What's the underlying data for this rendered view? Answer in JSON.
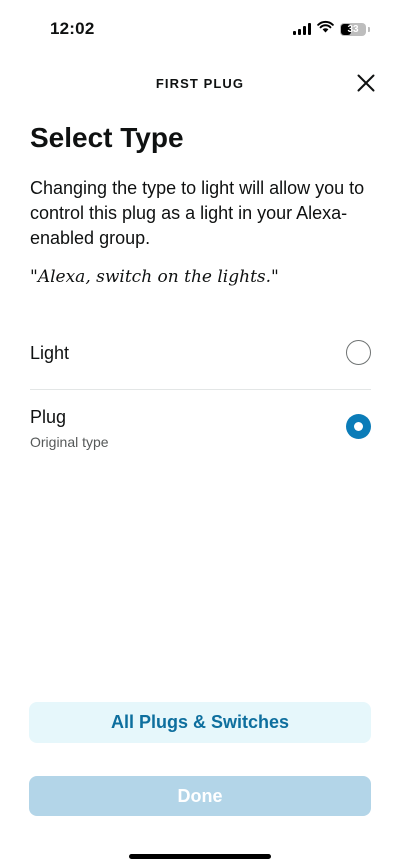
{
  "status_bar": {
    "time": "12:02",
    "battery_level": "33"
  },
  "header": {
    "title": "FIRST PLUG"
  },
  "page": {
    "title": "Select Type",
    "description": "Changing the type to light will allow you to control this plug as a light in your Alexa-enabled group.",
    "quote": "\"Alexa, switch on the lights.\""
  },
  "options": [
    {
      "label": "Light",
      "sublabel": "",
      "selected": false
    },
    {
      "label": "Plug",
      "sublabel": "Original type",
      "selected": true
    }
  ],
  "buttons": {
    "all_plugs_label": "All Plugs & Switches",
    "done_label": "Done"
  },
  "colors": {
    "accent": "#0b7cb8",
    "secondary_button_bg": "#e6f7fb",
    "secondary_button_text": "#0e6f9e",
    "done_button_bg": "#b3d5e8"
  }
}
